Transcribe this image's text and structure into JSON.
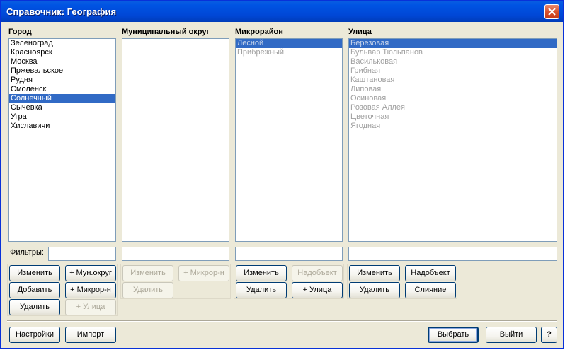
{
  "window": {
    "title": "Справочник: География"
  },
  "columns": {
    "city": {
      "label": "Город",
      "items": [
        "Зеленоград",
        "Красноярск",
        "Москва",
        "Пржевальское",
        "Рудня",
        "Смоленск",
        "Солнечный",
        "Сычевка",
        "Угра",
        "Хиславичи"
      ],
      "selected_index": 6
    },
    "district": {
      "label": "Муниципальный округ",
      "items": []
    },
    "microdistrict": {
      "label": "Микрорайон",
      "items": [
        "Лесной",
        "Прибрежный"
      ],
      "selected_index": 0
    },
    "street": {
      "label": "Улица",
      "items": [
        "Березовая",
        "Бульвар Тюльпанов",
        "Васильковая",
        "Грибная",
        "Каштановая",
        "Липовая",
        "Осиновая",
        "Розовая Аллея",
        "Цветочная",
        "Ягодная"
      ],
      "selected_index": 0
    }
  },
  "filters": {
    "label": "Фильтры:",
    "city": "",
    "district": "",
    "microdistrict": "",
    "street": ""
  },
  "buttons": {
    "city": {
      "edit": "Изменить",
      "add": "Добавить",
      "delete": "Удалить",
      "add_district": "+ Мун.округ",
      "add_micro": "+ Микрор-н",
      "add_street": "+ Улица"
    },
    "district": {
      "edit": "Изменить",
      "add_micro": "+ Микрор-н",
      "delete": "Удалить"
    },
    "micro": {
      "edit": "Изменить",
      "parent": "Надобъект",
      "delete": "Удалить",
      "add_street": "+ Улица"
    },
    "street": {
      "edit": "Изменить",
      "parent": "Надобъект",
      "delete": "Удалить",
      "merge": "Слияние"
    },
    "footer": {
      "settings": "Настройки",
      "import": "Импорт",
      "select": "Выбрать",
      "exit": "Выйти",
      "help": "?"
    }
  },
  "colors": {
    "title_bar": "#0054e3",
    "selection": "#316ac5",
    "window_bg": "#ece9d8"
  }
}
